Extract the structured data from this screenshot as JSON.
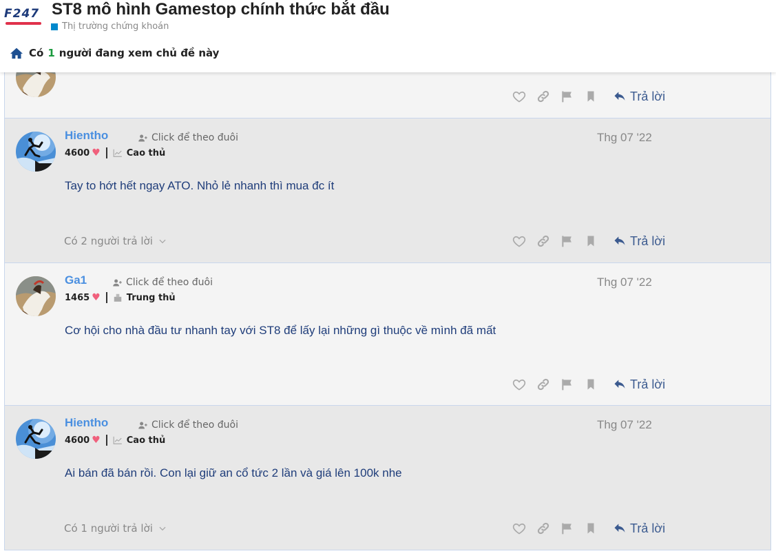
{
  "header": {
    "logo_text": "F247",
    "topic_title": "ST8 mô hình Gamestop chính thức bắt đầu",
    "category": "Thị trường chứng khoán",
    "category_color": "#0088cc",
    "viewing_prefix": "Có",
    "viewing_count": "1",
    "viewing_suffix": "người đang xem chủ đề này"
  },
  "actions": {
    "reply_label": "Trả lời",
    "icons": [
      "heart-icon",
      "link-icon",
      "flag-icon",
      "bookmark-icon",
      "reply-icon"
    ]
  },
  "posts": [
    {
      "username": "Hientho",
      "follow_label": "Click để theo đuôi",
      "score": "4600",
      "rank": "Cao thủ",
      "date": "Thg 07 '22",
      "content": "Tay to hớt hết ngay ATO. Nhỏ lẻ nhanh thì mua đc ít",
      "replies": "Có 2 người trả lời"
    },
    {
      "username": "Ga1",
      "follow_label": "Click để theo đuôi",
      "score": "1465",
      "rank": "Trung thủ",
      "date": "Thg 07 '22",
      "content": "Cơ hội cho nhà đầu tư nhanh tay với ST8 để lấy lại những gì thuộc về mình đã mất",
      "replies": ""
    },
    {
      "username": "Hientho",
      "follow_label": "Click để theo đuôi",
      "score": "4600",
      "rank": "Cao thủ",
      "date": "Thg 07 '22",
      "content": "Ai bán đã bán rồi. Con lại giữ an cổ tức 2 lần và giá lên 100k nhe",
      "replies": "Có 1 người trả lời"
    }
  ],
  "colors": {
    "username": "#4a8fe0",
    "content": "#1f3d7a",
    "heart": "#f0607c",
    "viewing_count": "#1a9a3e"
  }
}
